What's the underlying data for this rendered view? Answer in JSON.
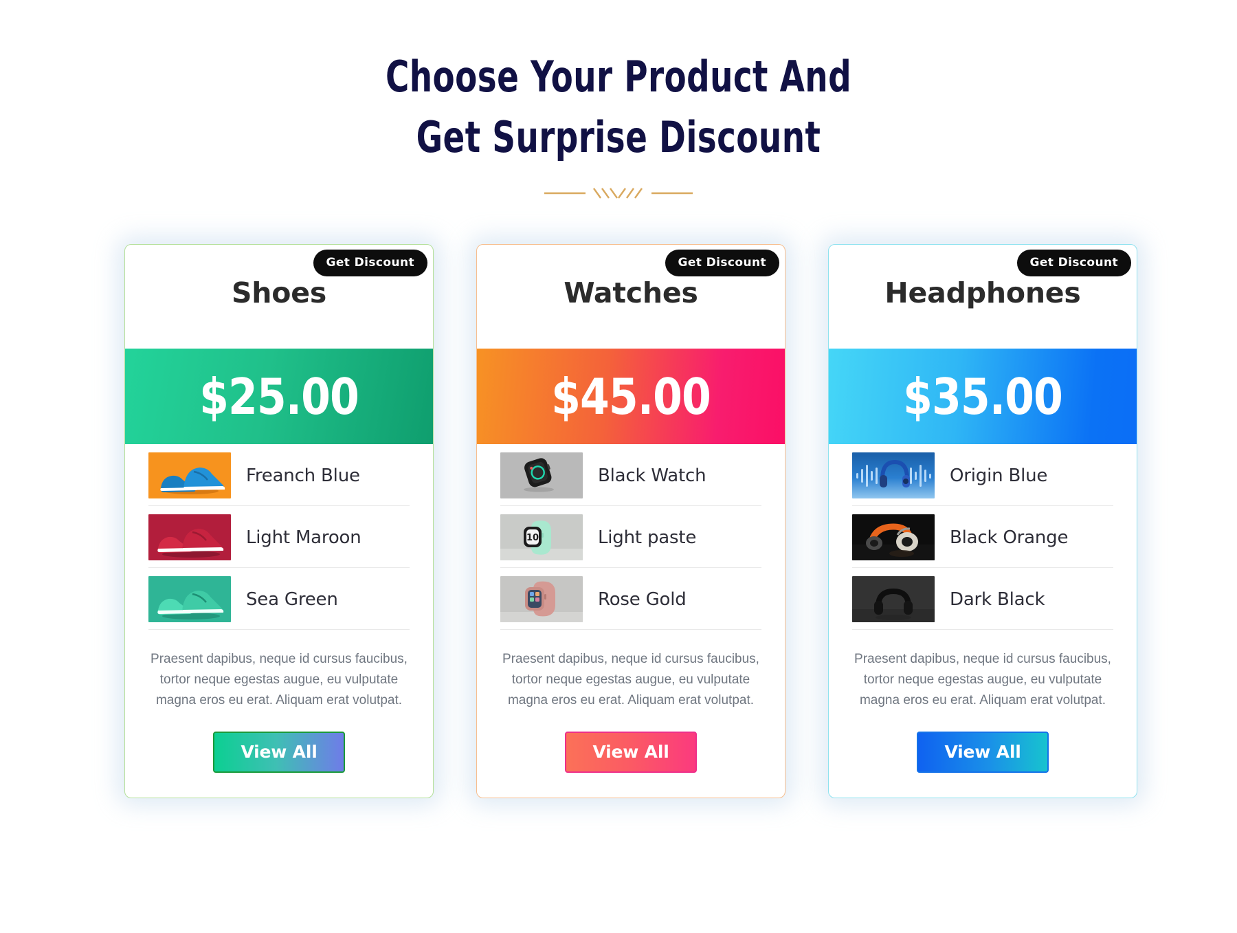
{
  "heading": {
    "line1": "Choose Your Product And",
    "line2": "Get Surprise Discount",
    "divider_icon": "ornament-divider-icon",
    "divider_color": "#d9a95f",
    "title_color": "#111144"
  },
  "cards": [
    {
      "badge_label": "Get Discount",
      "title": "Shoes",
      "price": "$25.00",
      "accent": "#2ecc8f",
      "border_color": "#b5e09b",
      "band_from": "#23d39a",
      "band_to": "#0f9e6e",
      "products": [
        {
          "name": "Freanch Blue",
          "thumb_icon": "shoe-blue-thumb"
        },
        {
          "name": "Light Maroon",
          "thumb_icon": "shoe-maroon-thumb"
        },
        {
          "name": "Sea Green",
          "thumb_icon": "shoe-seagreen-thumb"
        }
      ],
      "description": "Praesent dapibus, neque id cursus faucibus, tortor neque egestas augue, eu vulputate magna eros eu erat. Aliquam erat volutpat.",
      "button_label": "View All",
      "button_border": "#1a9a3a"
    },
    {
      "badge_label": "Get Discount",
      "title": "Watches",
      "price": "$45.00",
      "accent": "#f4623a",
      "border_color": "#f7be8e",
      "band_from": "#f79224",
      "band_to": "#fb0f66",
      "products": [
        {
          "name": "Black Watch",
          "thumb_icon": "watch-black-thumb"
        },
        {
          "name": "Light paste",
          "thumb_icon": "watch-mint-thumb"
        },
        {
          "name": "Rose Gold",
          "thumb_icon": "watch-rosegold-thumb"
        }
      ],
      "description": "Praesent dapibus, neque id cursus faucibus, tortor neque egestas augue, eu vulputate magna eros eu erat. Aliquam erat volutpat.",
      "button_label": "View All",
      "button_border": "#ee2f8a"
    },
    {
      "badge_label": "Get Discount",
      "title": "Headphones",
      "price": "$35.00",
      "accent": "#0b72f5",
      "border_color": "#8fe2ef",
      "band_from": "#45d6f7",
      "band_to": "#0b6ef6",
      "products": [
        {
          "name": "Origin Blue",
          "thumb_icon": "headphone-blue-thumb"
        },
        {
          "name": "Black Orange",
          "thumb_icon": "headphone-orange-thumb"
        },
        {
          "name": "Dark Black",
          "thumb_icon": "headphone-black-thumb"
        }
      ],
      "description": "Praesent dapibus, neque id cursus faucibus, tortor neque egestas augue, eu vulputate magna eros eu erat. Aliquam erat volutpat.",
      "button_label": "View All",
      "button_border": "#1472e8"
    }
  ]
}
